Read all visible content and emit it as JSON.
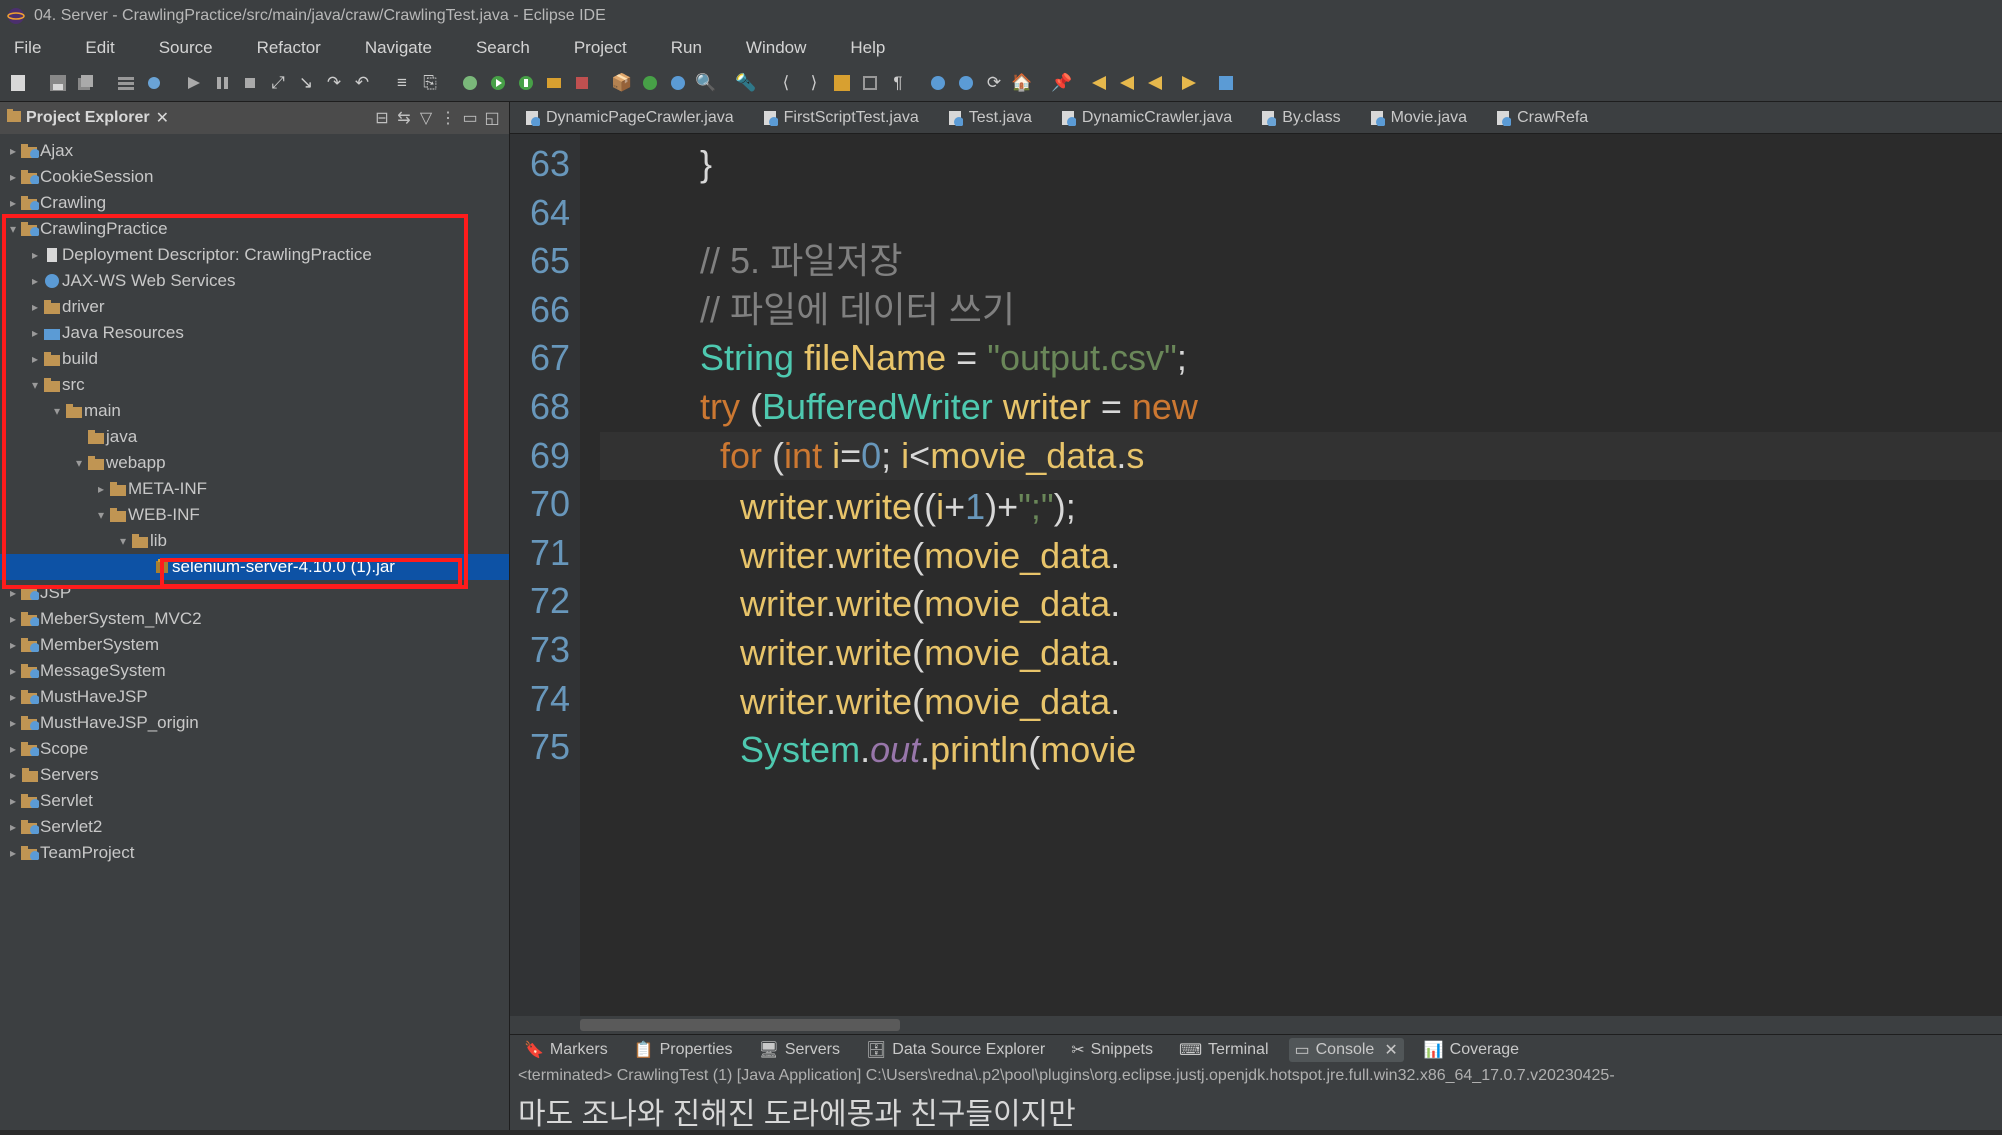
{
  "window": {
    "title": "04. Server - CrawlingPractice/src/main/java/craw/CrawlingTest.java - Eclipse IDE"
  },
  "menu": {
    "items": [
      "File",
      "Edit",
      "Source",
      "Refactor",
      "Navigate",
      "Search",
      "Project",
      "Run",
      "Window",
      "Help"
    ]
  },
  "explorer": {
    "title": "Project Explorer",
    "items": [
      {
        "depth": 0,
        "arrow": ">",
        "icon": "project",
        "label": "Ajax"
      },
      {
        "depth": 0,
        "arrow": ">",
        "icon": "project",
        "label": "CookieSession"
      },
      {
        "depth": 0,
        "arrow": ">",
        "icon": "project",
        "label": "Crawling"
      },
      {
        "depth": 0,
        "arrow": "v",
        "icon": "project",
        "label": "CrawlingPractice"
      },
      {
        "depth": 1,
        "arrow": ">",
        "icon": "desc",
        "label": "Deployment Descriptor: CrawlingPractice"
      },
      {
        "depth": 1,
        "arrow": ">",
        "icon": "ws",
        "label": "JAX-WS Web Services"
      },
      {
        "depth": 1,
        "arrow": ">",
        "icon": "folder",
        "label": "driver"
      },
      {
        "depth": 1,
        "arrow": ">",
        "icon": "javares",
        "label": "Java Resources"
      },
      {
        "depth": 1,
        "arrow": ">",
        "icon": "folder",
        "label": "build"
      },
      {
        "depth": 1,
        "arrow": "v",
        "icon": "folder",
        "label": "src"
      },
      {
        "depth": 2,
        "arrow": "v",
        "icon": "folder",
        "label": "main"
      },
      {
        "depth": 3,
        "arrow": "",
        "icon": "folder",
        "label": "java"
      },
      {
        "depth": 3,
        "arrow": "v",
        "icon": "folder",
        "label": "webapp"
      },
      {
        "depth": 4,
        "arrow": ">",
        "icon": "folder",
        "label": "META-INF"
      },
      {
        "depth": 4,
        "arrow": "v",
        "icon": "folder",
        "label": "WEB-INF"
      },
      {
        "depth": 5,
        "arrow": "v",
        "icon": "folder",
        "label": "lib"
      },
      {
        "depth": 6,
        "arrow": "",
        "icon": "jar",
        "label": "selenium-server-4.10.0 (1).jar",
        "selected": true
      },
      {
        "depth": 0,
        "arrow": ">",
        "icon": "project",
        "label": "JSP"
      },
      {
        "depth": 0,
        "arrow": ">",
        "icon": "project",
        "label": "MeberSystem_MVC2"
      },
      {
        "depth": 0,
        "arrow": ">",
        "icon": "project",
        "label": "MemberSystem"
      },
      {
        "depth": 0,
        "arrow": ">",
        "icon": "project",
        "label": "MessageSystem"
      },
      {
        "depth": 0,
        "arrow": ">",
        "icon": "project",
        "label": "MustHaveJSP"
      },
      {
        "depth": 0,
        "arrow": ">",
        "icon": "project",
        "label": "MustHaveJSP_origin"
      },
      {
        "depth": 0,
        "arrow": ">",
        "icon": "project",
        "label": "Scope"
      },
      {
        "depth": 0,
        "arrow": ">",
        "icon": "folder",
        "label": "Servers"
      },
      {
        "depth": 0,
        "arrow": ">",
        "icon": "project",
        "label": "Servlet"
      },
      {
        "depth": 0,
        "arrow": ">",
        "icon": "project",
        "label": "Servlet2"
      },
      {
        "depth": 0,
        "arrow": ">",
        "icon": "project",
        "label": "TeamProject"
      }
    ]
  },
  "editor": {
    "tabs": [
      {
        "label": "DynamicPageCrawler.java",
        "icon": "java"
      },
      {
        "label": "FirstScriptTest.java",
        "icon": "java"
      },
      {
        "label": "Test.java",
        "icon": "java"
      },
      {
        "label": "DynamicCrawler.java",
        "icon": "java"
      },
      {
        "label": "By.class",
        "icon": "class"
      },
      {
        "label": "Movie.java",
        "icon": "java"
      },
      {
        "label": "CrawRefa",
        "icon": "java"
      }
    ],
    "lines": [
      {
        "n": "63",
        "html": "          <span class='tok-brace'>}</span>"
      },
      {
        "n": "64",
        "html": ""
      },
      {
        "n": "65",
        "html": "          <span class='tok-comment'>// 5. 파일저장</span>"
      },
      {
        "n": "66",
        "html": "          <span class='tok-comment'>// 파일에 데이터 쓰기</span>"
      },
      {
        "n": "67",
        "html": "          <span class='tok-type'>String</span> <span class='tok-var'>fileName</span> = <span class='tok-string'>\"output.csv\"</span>;"
      },
      {
        "n": "68",
        "html": "          <span class='tok-kw2'>try</span> (<span class='tok-type'>BufferedWriter</span> <span class='tok-var'>writer</span> = <span class='tok-kw2'>new</span>"
      },
      {
        "n": "69",
        "html": "            <span class='tok-kw2'>for</span> (<span class='tok-kw2'>int</span> <span class='tok-var'>i</span>=<span class='tok-num'>0</span>; <span class='tok-var'>i</span>&lt;<span class='tok-var'>movie_data</span>.<span class='tok-method'>s</span>",
        "hl": true
      },
      {
        "n": "70",
        "html": "              <span class='tok-var'>writer</span>.<span class='tok-method'>write</span>((<span class='tok-var'>i</span>+<span class='tok-num'>1</span>)+<span class='tok-string'>\";\"</span>);"
      },
      {
        "n": "71",
        "html": "              <span class='tok-var'>writer</span>.<span class='tok-method'>write</span>(<span class='tok-var'>movie_data</span>."
      },
      {
        "n": "72",
        "html": "              <span class='tok-var'>writer</span>.<span class='tok-method'>write</span>(<span class='tok-var'>movie_data</span>."
      },
      {
        "n": "73",
        "html": "              <span class='tok-var'>writer</span>.<span class='tok-method'>write</span>(<span class='tok-var'>movie_data</span>."
      },
      {
        "n": "74",
        "html": "              <span class='tok-var'>writer</span>.<span class='tok-method'>write</span>(<span class='tok-var'>movie_data</span>."
      },
      {
        "n": "75",
        "html": "              <span class='tok-type'>System</span>.<span class='tok-field'>out</span>.<span class='tok-method'>println</span>(<span class='tok-var'>movie</span>"
      }
    ]
  },
  "bottom": {
    "tabs": [
      {
        "label": "Markers",
        "active": false
      },
      {
        "label": "Properties",
        "active": false
      },
      {
        "label": "Servers",
        "active": false
      },
      {
        "label": "Data Source Explorer",
        "active": false
      },
      {
        "label": "Snippets",
        "active": false
      },
      {
        "label": "Terminal",
        "active": false
      },
      {
        "label": "Console",
        "active": true
      },
      {
        "label": "Coverage",
        "active": false
      }
    ],
    "status": "<terminated> CrawlingTest (1) [Java Application] C:\\Users\\redna\\.p2\\pool\\plugins\\org.eclipse.justj.openjdk.hotspot.jre.full.win32.x86_64_17.0.7.v20230425-",
    "output": "마도 조나와   진해진   도라에몽과   친구들이지만"
  }
}
